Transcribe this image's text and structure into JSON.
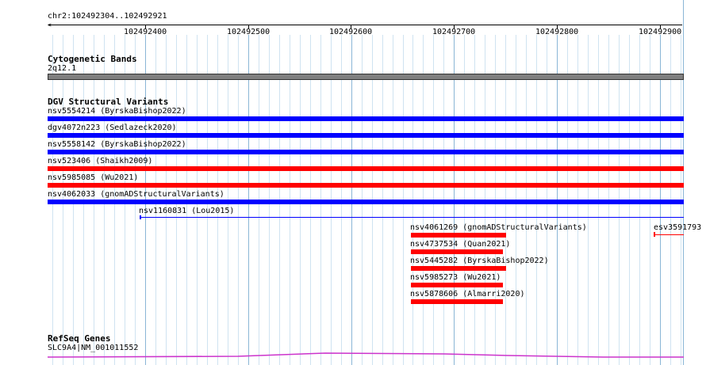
{
  "ruler": {
    "location": "chr2:102492304..102492921",
    "ticks": [
      "102492400",
      "102492500",
      "102492600",
      "102492700",
      "102492800",
      "102492900"
    ]
  },
  "cytoband": {
    "title": "Cytogenetic Bands",
    "band": "2q12.1",
    "color": "#808080"
  },
  "dgv": {
    "title": "DGV Structural Variants",
    "colors": {
      "gain": "#0000ff",
      "loss": "#ff0000"
    },
    "features": [
      "nsv5554214 (ByrskaBishop2022)",
      "dgv4072n223 (Sedlazeck2020)",
      "nsv5558142 (ByrskaBishop2022)",
      "nsv523406 (Shaikh2009)",
      "nsv5985085 (Wu2021)",
      "nsv4062033 (gnomADStructuralVariants)",
      "nsv1160831 (Lou2015)",
      "nsv4061269 (gnomADStructuralVariants)",
      "nsv4737534 (Quan2021)",
      "nsv5445282 (ByrskaBishop2022)",
      "nsv5985273 (Wu2021)",
      "nsv5878606 (Almarri2020)",
      "esv3591793"
    ]
  },
  "refseq": {
    "title": "RefSeq Genes",
    "gene": "SLC9A4|NM_001011552",
    "color": "#cc33cc"
  }
}
